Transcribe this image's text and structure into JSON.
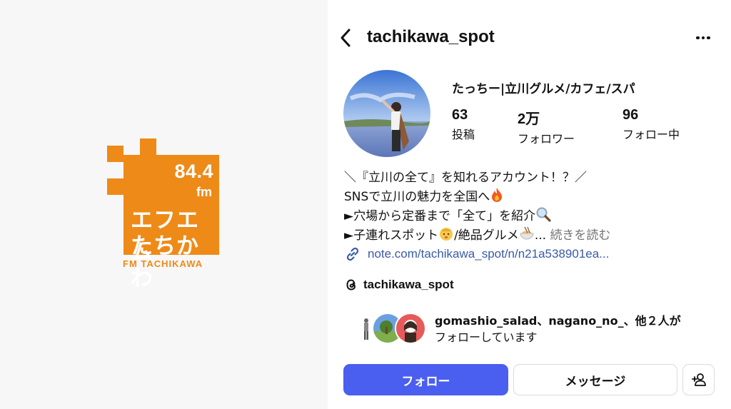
{
  "logo": {
    "frequency": "84.4",
    "unit": "fm",
    "name_line1": "エフエム",
    "name_line2": "たちかわ",
    "subtitle": "FM TACHIKAWA",
    "brand_color": "#ee8a17"
  },
  "header": {
    "username": "tachikawa_spot"
  },
  "profile": {
    "display_name": "たっちー|立川グルメ/カフェ/スパ",
    "stats": [
      {
        "value": "63",
        "label": "投稿"
      },
      {
        "value": "2万",
        "label": "フォロワー"
      },
      {
        "value": "96",
        "label": "フォロー中"
      }
    ],
    "bio": {
      "line1": "＼『立川の全て』を知れるアカウント！？／",
      "line2": "SNSで立川の魅力を全国へ",
      "line3": "►穴場から定番まで「全て」を紹介",
      "line4": "►子連れスポット",
      "line4b": "/絶品グルメ",
      "ellipsis": "...",
      "more": "続きを読む"
    },
    "link": "note.com/tachikawa_spot/n/n21a538901ea...",
    "threads": "tachikawa_spot",
    "followed_by": {
      "line1_names": "gomashio_salad、nagano_no_",
      "line1_rest": "、他２人が",
      "line2": "フォローしています"
    }
  },
  "actions": {
    "follow": "フォロー",
    "message": "メッセージ"
  },
  "colors": {
    "accent": "#4a5ef0",
    "link": "#3a5ba8",
    "muted": "#737373"
  },
  "icons": [
    "back-arrow-icon",
    "more-dots-icon",
    "link-icon",
    "threads-icon",
    "add-person-icon",
    "fire-icon",
    "magnifier-icon",
    "baby-icon",
    "noodles-icon"
  ]
}
